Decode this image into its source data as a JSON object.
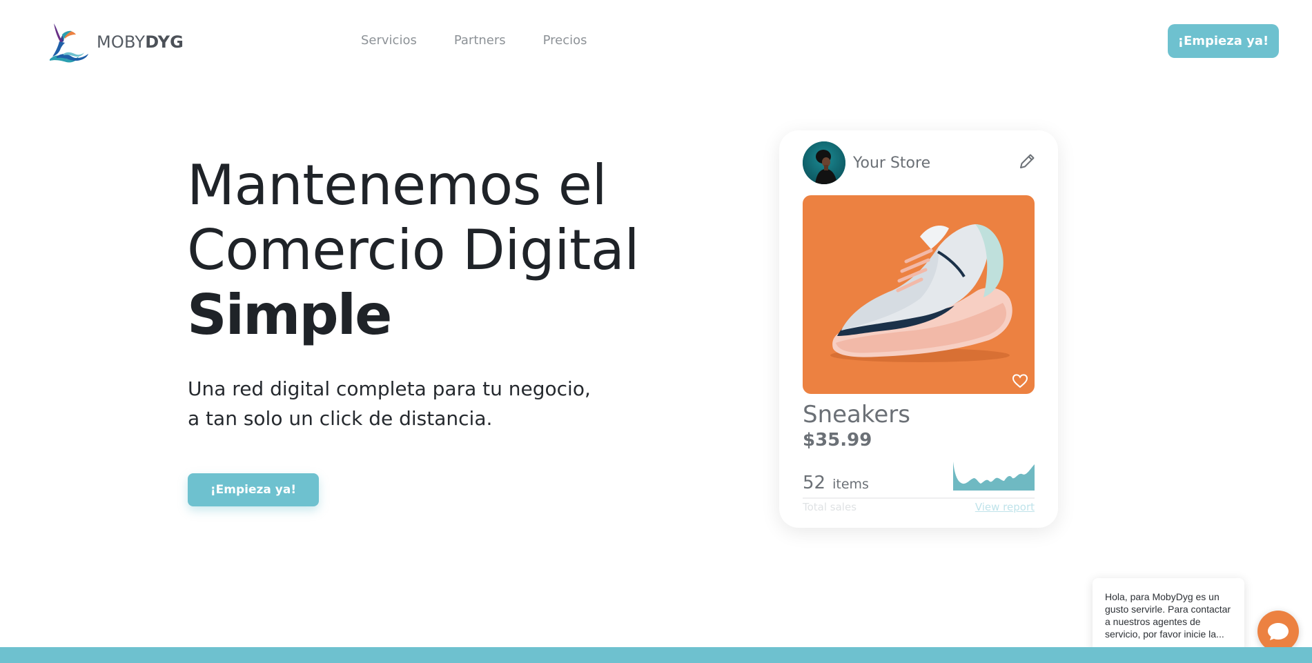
{
  "brand": {
    "name_light": "MOBY",
    "name_bold": "DYG"
  },
  "nav": {
    "items": [
      {
        "label": "Servicios"
      },
      {
        "label": "Partners"
      },
      {
        "label": "Precios"
      }
    ]
  },
  "header": {
    "cta_label": "¡Empieza ya!"
  },
  "hero": {
    "title_line1": "Mantenemos el",
    "title_line2": "Comercio Digital",
    "title_strong": "Simple",
    "subtitle_line1": "Una red digital completa para tu negocio,",
    "subtitle_line2": "a tan solo un click de distancia.",
    "cta_label": "¡Empieza ya!"
  },
  "store_card": {
    "store_name": "Your Store",
    "product_name": "Sneakers",
    "product_price": "$35.99",
    "sales_count": "52",
    "sales_unit": "items",
    "sales_label": "Total sales",
    "report_link": "View report",
    "icons": {
      "edit": "pencil-icon",
      "favorite": "heart-icon"
    }
  },
  "chat": {
    "message": "Hola, para MobyDyg es un gusto servirle. Para contactar a nuestros agentes de servicio, por favor inicie la...",
    "icon": "chat-icon"
  },
  "colors": {
    "accent": "#6ec1cf",
    "product_bg": "#ec8141",
    "chat_button": "#ec8141",
    "text_dark": "#1f2328",
    "text_muted": "#6b7076"
  }
}
